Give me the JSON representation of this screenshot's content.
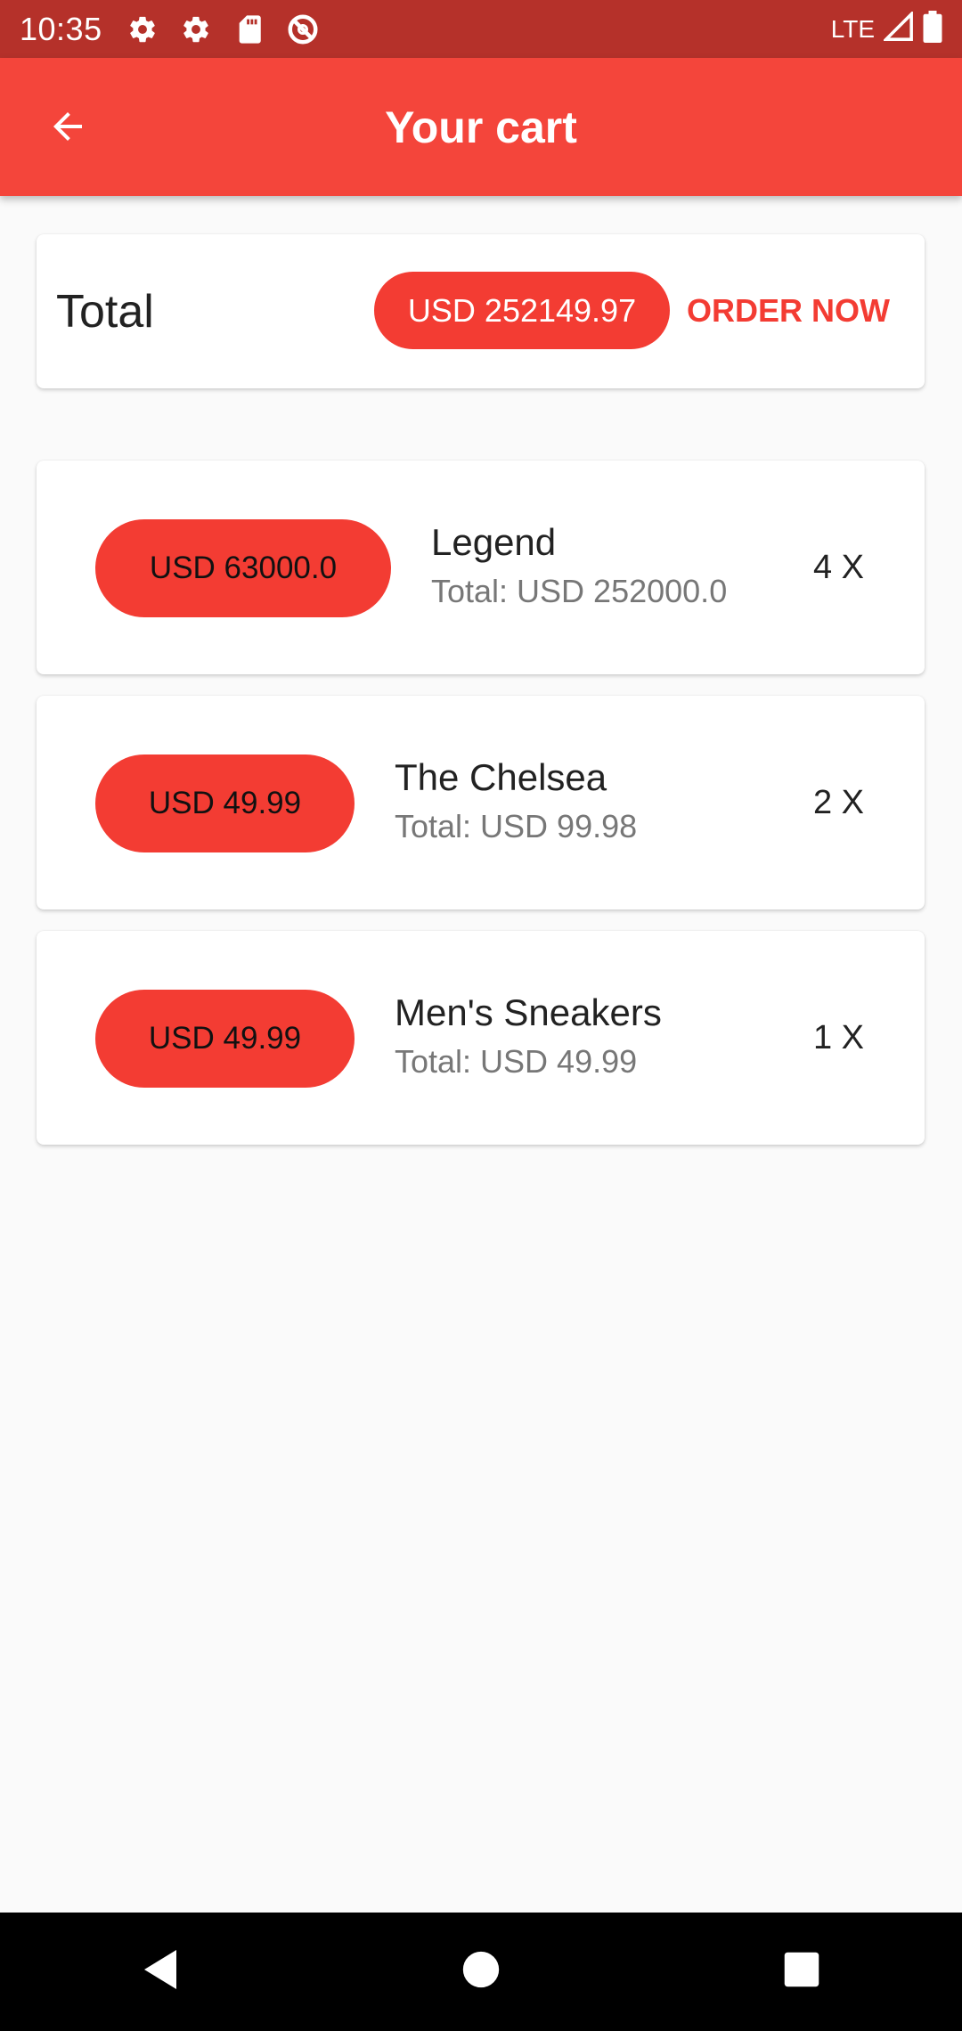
{
  "status_bar": {
    "time": "10:35",
    "network": "LTE",
    "icons": [
      "gear-icon",
      "gear-icon",
      "sd-card-icon",
      "no-disturb-icon",
      "signal-icon",
      "battery-icon"
    ]
  },
  "app_bar": {
    "title": "Your cart",
    "back_icon": "arrow-left-icon"
  },
  "summary": {
    "label": "Total",
    "amount": "USD 252149.97",
    "order_button": "ORDER NOW"
  },
  "items": [
    {
      "price": "USD 63000.0",
      "title": "Legend",
      "total": "Total: USD 252000.0",
      "qty": "4 X"
    },
    {
      "price": "USD 49.99",
      "title": "The Chelsea",
      "total": "Total: USD 99.98",
      "qty": "2 X"
    },
    {
      "price": "USD 49.99",
      "title": "Men's Sneakers",
      "total": "Total: USD 49.99",
      "qty": "1 X"
    }
  ],
  "colors": {
    "status_bar": "#b5312a",
    "app_bar": "#f4453b",
    "accent": "#f33c33",
    "background": "#fafafa"
  },
  "nav_bar": {
    "icons": [
      "back-triangle-icon",
      "home-circle-icon",
      "recents-square-icon"
    ]
  }
}
